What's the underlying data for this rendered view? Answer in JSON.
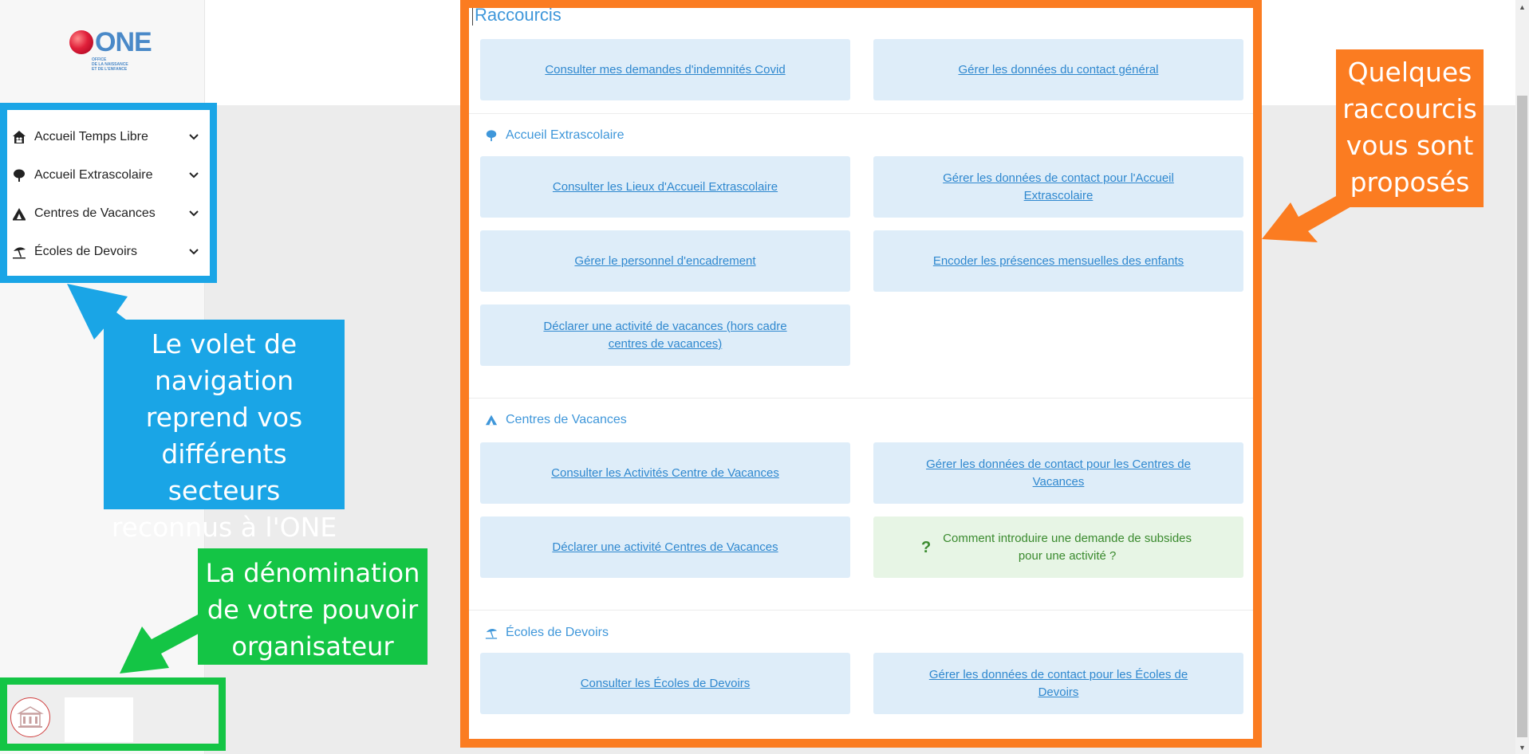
{
  "logo": {
    "word": "ONE",
    "subtitle": "Office de la Naissance et de l'Enfance"
  },
  "nav": {
    "items": [
      {
        "label": "Accueil Temps Libre",
        "icon": "house-family-icon"
      },
      {
        "label": "Accueil Extrascolaire",
        "icon": "tree-icon"
      },
      {
        "label": "Centres de Vacances",
        "icon": "tent-icon"
      },
      {
        "label": "Écoles de Devoirs",
        "icon": "umbrella-beach-icon"
      }
    ]
  },
  "main": {
    "title": "Raccourcis",
    "general_links": [
      "Consulter mes demandes d'indemnités Covid",
      "Gérer les données du contact général"
    ],
    "sections": [
      {
        "title": "Accueil Extrascolaire",
        "icon": "tree-icon",
        "links": [
          "Consulter les Lieux d'Accueil Extrascolaire",
          "Gérer les données de contact pour l'Accueil Extrascolaire",
          "Gérer le personnel d'encadrement",
          "Encoder les présences mensuelles des enfants",
          "Déclarer une activité de vacances (hors cadre centres de vacances)"
        ]
      },
      {
        "title": "Centres de Vacances",
        "icon": "tent-icon",
        "links": [
          "Consulter les Activités Centre de Vacances",
          "Gérer les données de contact pour les Centres de Vacances",
          "Déclarer une activité Centres de Vacances"
        ],
        "help": "Comment introduire une demande de subsides pour une activité ?"
      },
      {
        "title": "Écoles de Devoirs",
        "icon": "umbrella-beach-icon",
        "links": [
          "Consulter les Écoles de Devoirs",
          "Gérer les données de contact pour les Écoles de Devoirs"
        ]
      }
    ]
  },
  "callouts": {
    "navigation": "Le volet de navigation reprend vos différents secteurs reconnus à l'ONE",
    "organisateur": "La dénomination de votre pouvoir organisateur",
    "raccourcis": "Quelques raccourcis vous sont proposés"
  },
  "colors": {
    "accent_blue": "#1aa5e6",
    "accent_green": "#14c545",
    "accent_orange": "#fb7c21",
    "link_blue": "#2f88cf",
    "card_bg": "#deedf9",
    "help_bg": "#e7f5e5"
  }
}
